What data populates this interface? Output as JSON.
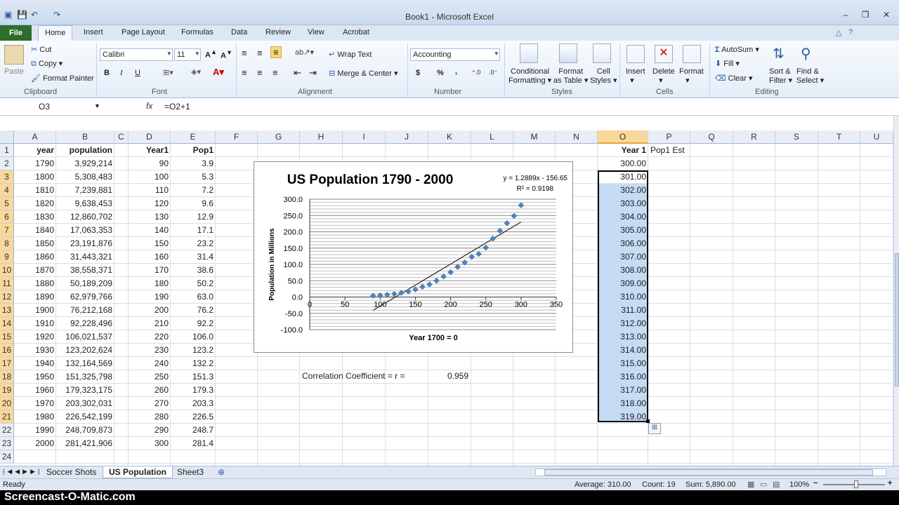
{
  "window": {
    "title": "Book1 - Microsoft Excel",
    "controls": [
      "–",
      "❐",
      "✕"
    ]
  },
  "ribbon_tabs": [
    "File",
    "Home",
    "Insert",
    "Page Layout",
    "Formulas",
    "Data",
    "Review",
    "View",
    "Acrobat"
  ],
  "ribbon": {
    "clipboard": {
      "label": "Clipboard",
      "paste": "Paste",
      "cut": "Cut",
      "copy": "Copy",
      "format_painter": "Format Painter"
    },
    "font": {
      "label": "Font",
      "name": "Calibri",
      "size": "11",
      "bold": "B",
      "italic": "I",
      "underline": "U"
    },
    "alignment": {
      "label": "Alignment",
      "wrap": "Wrap Text",
      "merge": "Merge & Center"
    },
    "number": {
      "label": "Number",
      "format": "Accounting",
      "currency": "$",
      "percent": "%",
      "comma": ","
    },
    "styles": {
      "label": "Styles",
      "conditional": "Conditional",
      "conditional2": "Formatting",
      "format_table": "Format",
      "format_table2": "as Table",
      "cell_styles": "Cell",
      "cell_styles2": "Styles"
    },
    "cells": {
      "label": "Cells",
      "insert": "Insert",
      "delete": "Delete",
      "format": "Format"
    },
    "editing": {
      "label": "Editing",
      "autosum": "AutoSum",
      "fill": "Fill",
      "clear": "Clear",
      "sort": "Sort &",
      "sort2": "Filter",
      "find": "Find &",
      "find2": "Select"
    }
  },
  "formula_bar": {
    "name_box": "O3",
    "fx": "fx",
    "formula": "=O2+1"
  },
  "columns": [
    "A",
    "B",
    "C",
    "D",
    "E",
    "F",
    "G",
    "H",
    "I",
    "J",
    "K",
    "L",
    "M",
    "N",
    "O",
    "P",
    "Q",
    "R",
    "S",
    "T",
    "U"
  ],
  "rows": [
    "1",
    "2",
    "3",
    "4",
    "5",
    "6",
    "7",
    "8",
    "9",
    "10",
    "11",
    "12",
    "13",
    "14",
    "15",
    "16",
    "17",
    "18",
    "19",
    "20",
    "21",
    "22",
    "23",
    "24"
  ],
  "headers": {
    "year": "year",
    "population": "population",
    "year1": "Year1",
    "pop1": "Pop1",
    "o_year1": "Year 1",
    "p_popest": "Pop1 Est"
  },
  "table": [
    [
      "1790",
      "3,929,214",
      "90",
      "3.9"
    ],
    [
      "1800",
      "5,308,483",
      "100",
      "5.3"
    ],
    [
      "1810",
      "7,239,881",
      "110",
      "7.2"
    ],
    [
      "1820",
      "9,638,453",
      "120",
      "9.6"
    ],
    [
      "1830",
      "12,860,702",
      "130",
      "12.9"
    ],
    [
      "1840",
      "17,063,353",
      "140",
      "17.1"
    ],
    [
      "1850",
      "23,191,876",
      "150",
      "23.2"
    ],
    [
      "1860",
      "31,443,321",
      "160",
      "31.4"
    ],
    [
      "1870",
      "38,558,371",
      "170",
      "38.6"
    ],
    [
      "1880",
      "50,189,209",
      "180",
      "50.2"
    ],
    [
      "1890",
      "62,979,766",
      "190",
      "63.0"
    ],
    [
      "1900",
      "76,212,168",
      "200",
      "76.2"
    ],
    [
      "1910",
      "92,228,496",
      "210",
      "92.2"
    ],
    [
      "1920",
      "106,021,537",
      "220",
      "106.0"
    ],
    [
      "1930",
      "123,202,624",
      "230",
      "123.2"
    ],
    [
      "1940",
      "132,164,569",
      "240",
      "132.2"
    ],
    [
      "1950",
      "151,325,798",
      "250",
      "151.3"
    ],
    [
      "1960",
      "179,323,175",
      "260",
      "179.3"
    ],
    [
      "1970",
      "203,302,031",
      "270",
      "203.3"
    ],
    [
      "1980",
      "226,542,199",
      "280",
      "226.5"
    ],
    [
      "1990",
      "248,709,873",
      "290",
      "248.7"
    ],
    [
      "2000",
      "281,421,906",
      "300",
      "281.4"
    ]
  ],
  "o_column": [
    "300.00",
    "301.00",
    "302.00",
    "303.00",
    "304.00",
    "305.00",
    "306.00",
    "307.00",
    "308.00",
    "309.00",
    "310.00",
    "311.00",
    "312.00",
    "313.00",
    "314.00",
    "315.00",
    "316.00",
    "317.00",
    "318.00",
    "319.00"
  ],
  "correlation": {
    "label": "Correlation Coefficient = r =",
    "value": "0.959"
  },
  "chart_data": {
    "type": "scatter",
    "title": "US Population 1790 - 2000",
    "xlabel": "Year  1700 = 0",
    "ylabel": "Population  in Millions",
    "xlim": [
      0,
      350
    ],
    "ylim": [
      -100,
      300
    ],
    "xticks": [
      "0",
      "50",
      "100",
      "150",
      "200",
      "250",
      "300",
      "350"
    ],
    "yticks": [
      "300.0",
      "250.0",
      "200.0",
      "150.0",
      "100.0",
      "50.0",
      "0.0",
      "-50.0",
      "-100.0"
    ],
    "x": [
      90,
      100,
      110,
      120,
      130,
      140,
      150,
      160,
      170,
      180,
      190,
      200,
      210,
      220,
      230,
      240,
      250,
      260,
      270,
      280,
      290,
      300
    ],
    "y": [
      3.9,
      5.3,
      7.2,
      9.6,
      12.9,
      17.1,
      23.2,
      31.4,
      38.6,
      50.2,
      63.0,
      76.2,
      92.2,
      106.0,
      123.2,
      132.2,
      151.3,
      179.3,
      203.3,
      226.5,
      248.7,
      281.4
    ],
    "trendline": {
      "slope": 1.2889,
      "intercept": -156.65,
      "x_range": [
        90,
        300
      ]
    },
    "equation": "y = 1.2889x - 156.65",
    "r2": "R² = 0.9198",
    "grid": true,
    "marker_color": "#4f81bd"
  },
  "sheet_tabs": [
    "Soccer Shots",
    "US Population",
    "Sheet3"
  ],
  "status": {
    "ready": "Ready",
    "average": "Average: 310.00",
    "count": "Count: 19",
    "sum": "Sum: 5,890.00",
    "zoom": "100%"
  },
  "watermark": "Screencast-O-Matic.com"
}
